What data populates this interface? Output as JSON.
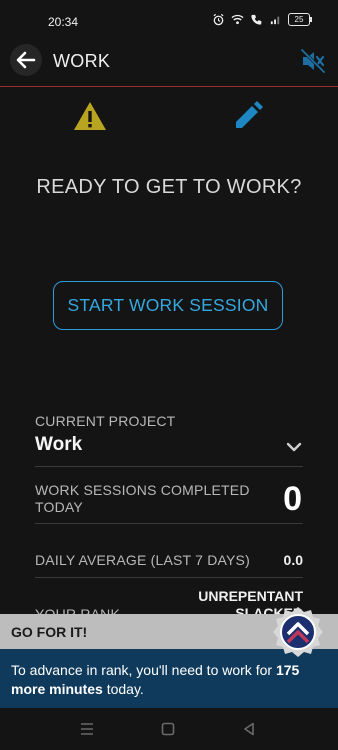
{
  "status": {
    "time": "20:34",
    "battery": "25"
  },
  "header": {
    "title": "WORK"
  },
  "main": {
    "ready_text": "READY TO GET TO WORK?",
    "start_button": "START WORK SESSION"
  },
  "stats": {
    "project_label": "CURRENT PROJECT",
    "project_value": "Work",
    "sessions_label": "WORK SESSIONS COMPLETED TODAY",
    "sessions_value": "0",
    "average_label": "DAILY AVERAGE (LAST 7 DAYS)",
    "average_value": "0.0",
    "rank_label": "YOUR RANK",
    "rank_value": "UNREPENTANT SLACKER"
  },
  "banner": {
    "title": "GO FOR IT!",
    "message_pre": "To advance in rank, you'll need to work for ",
    "message_bold": "175 more minutes",
    "message_post": " today."
  },
  "colors": {
    "accent": "#35a8e0",
    "warning": "#b8a420",
    "banner_bg": "#0f3a5c",
    "header_rule": "#9a2a2a"
  }
}
